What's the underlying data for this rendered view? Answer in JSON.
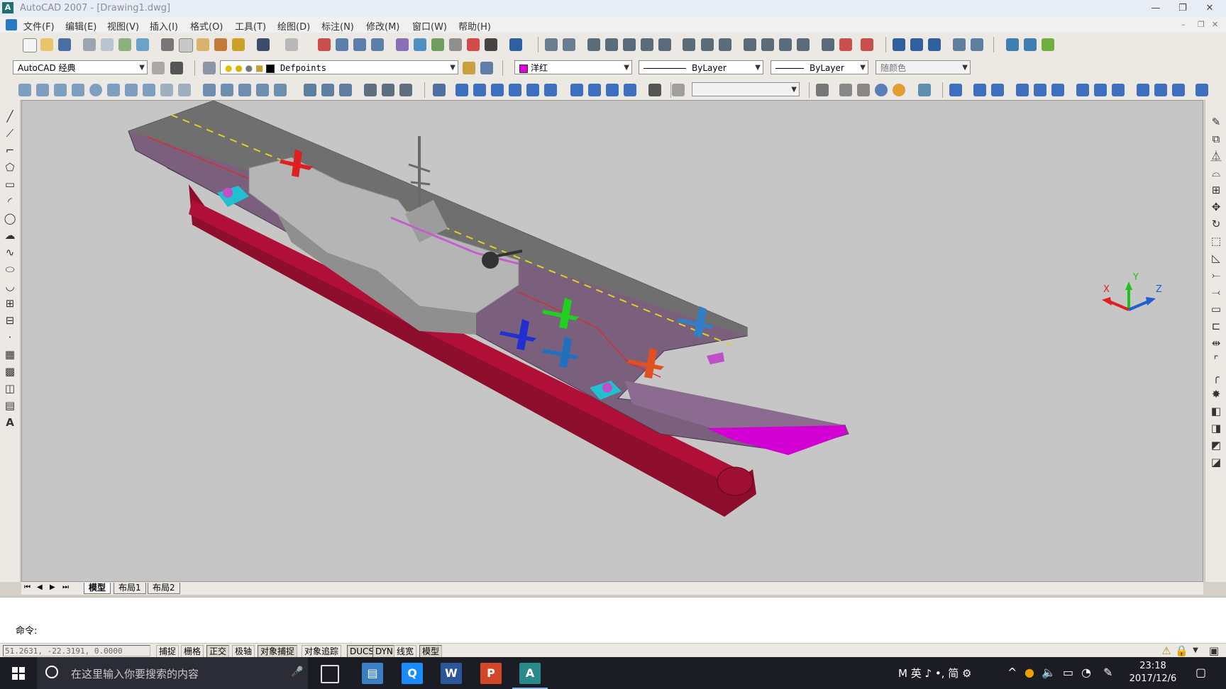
{
  "window": {
    "title": "AutoCAD 2007 - [Drawing1.dwg]",
    "minimize_label": "—",
    "restore_label": "❐",
    "close_label": "✕"
  },
  "menu": {
    "items": [
      "文件(F)",
      "编辑(E)",
      "视图(V)",
      "插入(I)",
      "格式(O)",
      "工具(T)",
      "绘图(D)",
      "标注(N)",
      "修改(M)",
      "窗口(W)",
      "帮助(H)"
    ]
  },
  "workspace": {
    "value": "AutoCAD 经典"
  },
  "layer": {
    "value": "Defpoints"
  },
  "properties": {
    "color": "洋红",
    "color_hex": "#e000e0",
    "linetype": "ByLayer",
    "lineweight": "ByLayer",
    "plotstyle": "随颜色"
  },
  "layout_tabs": [
    "模型",
    "布局1",
    "布局2"
  ],
  "command": {
    "prompt": "命令:",
    "value": ""
  },
  "status": {
    "coords": "51.2631, -22.3191, 0.0000",
    "toggles": [
      {
        "label": "捕捉",
        "on": false
      },
      {
        "label": "栅格",
        "on": false
      },
      {
        "label": "正交",
        "on": true
      },
      {
        "label": "极轴",
        "on": false
      },
      {
        "label": "对象捕捉",
        "on": true
      },
      {
        "label": "对象追踪",
        "on": false
      },
      {
        "label": "DUCS",
        "on": true
      },
      {
        "label": "DYN",
        "on": true
      },
      {
        "label": "线宽",
        "on": false
      },
      {
        "label": "模型",
        "on": true
      }
    ]
  },
  "ucs_icon": {
    "x": "X",
    "y": "Y",
    "z": "Z"
  },
  "taskbar": {
    "search_placeholder": "在这里输入你要搜索的内容",
    "ime": "M 英 ♪ •, 简 ⚙",
    "time": "23:18",
    "date": "2017/12/6"
  },
  "colors": {
    "hull_red": "#b01038",
    "deck_purple": "#7c5e80",
    "flight_deck_gray": "#6f6f6f",
    "island_gray": "#b5b5b5",
    "accent_magenta": "#d300d3",
    "viewport_bg": "#c6c6c6"
  }
}
